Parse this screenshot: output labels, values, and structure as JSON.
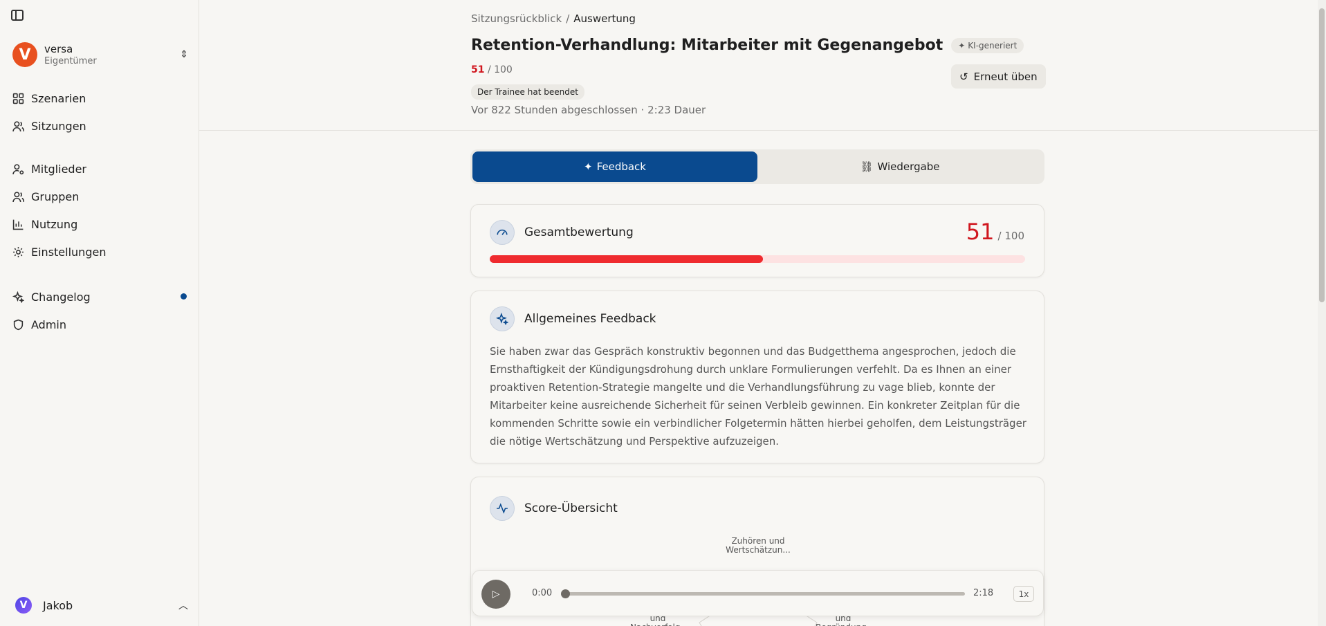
{
  "sidebar": {
    "workspace": {
      "initial": "V",
      "name": "versa",
      "role": "Eigentümer"
    },
    "nav_group1": [
      {
        "label": "Szenarien",
        "icon": "grid-icon"
      },
      {
        "label": "Sitzungen",
        "icon": "users-icon"
      }
    ],
    "nav_group2": [
      {
        "label": "Mitglieder",
        "icon": "user-cog-icon"
      },
      {
        "label": "Gruppen",
        "icon": "users-icon"
      },
      {
        "label": "Nutzung",
        "icon": "bar-chart-icon"
      },
      {
        "label": "Einstellungen",
        "icon": "gear-icon"
      }
    ],
    "nav_group3": [
      {
        "label": "Changelog",
        "icon": "sparkles-icon",
        "badge": true
      },
      {
        "label": "Admin",
        "icon": "shield-icon"
      }
    ],
    "user": {
      "initial": "V",
      "name": "Jakob"
    }
  },
  "header": {
    "breadcrumb": {
      "parent": "Sitzungsrückblick",
      "separator": "/",
      "current": "Auswertung"
    },
    "title": "Retention-Verhandlung: Mitarbeiter mit Gegenangebot",
    "ai_badge": "KI-generiert",
    "score": {
      "value": "51",
      "max": "/ 100"
    },
    "status": "Der Trainee hat beendet",
    "meta": "Vor 822 Stunden abgeschlossen · 2:23 Dauer",
    "retry_label": "Erneut üben"
  },
  "tabs": [
    {
      "label": "Feedback",
      "active": true
    },
    {
      "label": "Wiedergabe",
      "active": false
    }
  ],
  "overall": {
    "title": "Gesamtbewertung",
    "score": "51",
    "max": "/ 100",
    "fraction": 0.51,
    "bar_color": "#ef2b2f"
  },
  "feedback": {
    "title": "Allgemeines Feedback",
    "text": "Sie haben zwar das Gespräch konstruktiv begonnen und das Budgetthema angesprochen, jedoch die Ernsthaftigkeit der Kündigungsdrohung durch unklare Formulierungen verfehlt. Da es Ihnen an einer proaktiven Retention-Strategie mangelte und die Verhandlungsführung zu vage blieb, konnte der Mitarbeiter keine ausreichende Sicherheit für seinen Verbleib gewinnen. Ein konkreter Zeitplan für die kommenden Schritte sowie ein verbindlicher Folgetermin hätten hierbei geholfen, dem Leistungsträger die nötige Wertschätzung und Perspektive aufzuzeigen."
  },
  "scores": {
    "title": "Score-Übersicht",
    "radar_labels": {
      "top": "Zuhören und Wertschätzun...",
      "left": "und Nachverfolg...",
      "right": "und Begründung..."
    }
  },
  "player": {
    "current": "0:00",
    "total": "2:18",
    "speed": "1x",
    "progress": 0.0
  },
  "colors": {
    "accent": "#0a4a8f",
    "score_red": "#d0161e",
    "brand": "#e8501f"
  }
}
